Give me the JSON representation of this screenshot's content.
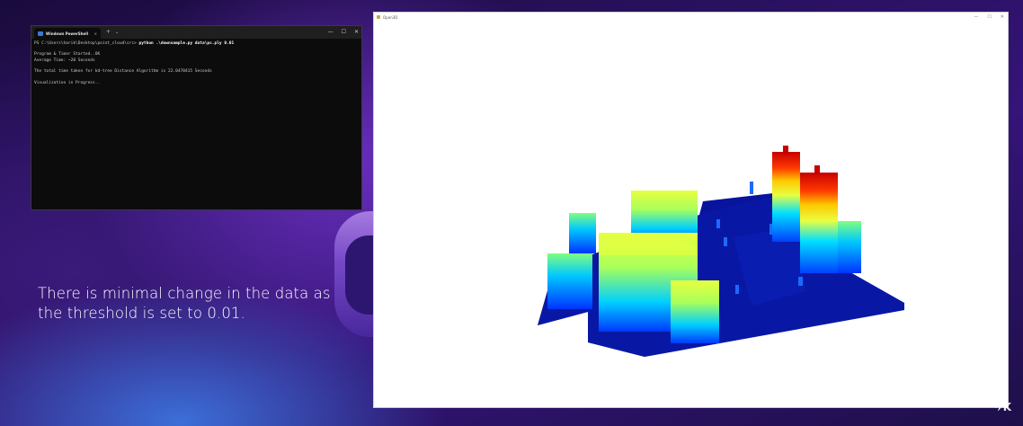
{
  "terminal": {
    "tab_title": "Windows PowerShell",
    "tab_close": "×",
    "new_tab": "+",
    "dropdown": "⌄",
    "controls": {
      "minimize": "—",
      "maximize": "☐",
      "close": "✕"
    },
    "prompt": "PS C:\\Users\\harik\\Desktop\\point_cloud\\src> ",
    "command": "python .\\downsample.py data\\pc.ply 0.01",
    "lines": [
      "Program & Timer Started..OK",
      "Average Time: ~20 Seconds",
      "The total time taken for kd-tree Distance Algorithm is 22.0470415 Seconds",
      "Visualization in Progress.."
    ]
  },
  "caption": {
    "text": "There is minimal change in the data as the threshold is set to 0.01."
  },
  "open3d": {
    "title": "Open3D",
    "controls": {
      "minimize": "—",
      "maximize": "☐",
      "close": "✕"
    },
    "colormap": [
      "#00008b",
      "#0033ff",
      "#00c8ff",
      "#7fff7f",
      "#e8ff40",
      "#ffc800",
      "#ff3a00",
      "#c80000"
    ]
  },
  "watermark": "✈K"
}
